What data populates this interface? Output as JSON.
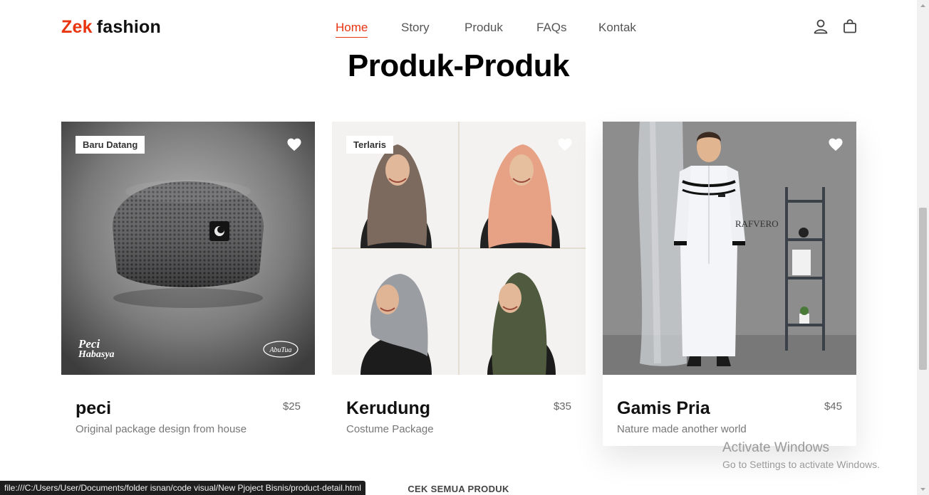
{
  "header": {
    "logo_brand": "Zek",
    "logo_rest": "fashion",
    "nav": [
      "Home",
      "Story",
      "Produk",
      "FAQs",
      "Kontak"
    ],
    "icons": [
      "user-icon",
      "shopping-bag-icon"
    ]
  },
  "section": {
    "title": "Produk-Produk"
  },
  "products": [
    {
      "badge": "Baru Datang",
      "name": "peci",
      "price": "$25",
      "desc": "Original package design from house",
      "image_text": [
        "Peci Habasya",
        "AbuTua"
      ]
    },
    {
      "badge": "Terlaris",
      "name": "Kerudung",
      "price": "$35",
      "desc": "Costume Package"
    },
    {
      "badge": "",
      "name": "Gamis Pria",
      "price": "$45",
      "desc": "Nature made another world",
      "image_text": [
        "RAFVERO"
      ]
    }
  ],
  "see_all": "CEK SEMUA PRODUK",
  "status_url": "file:///C:/Users/User/Documents/folder isnan/code visual/New Pjoject Bisnis/product-detail.html",
  "watermark": {
    "line1": "Activate Windows",
    "line2": "Go to Settings to activate Windows."
  },
  "colors": {
    "accent": "#e8340f"
  }
}
